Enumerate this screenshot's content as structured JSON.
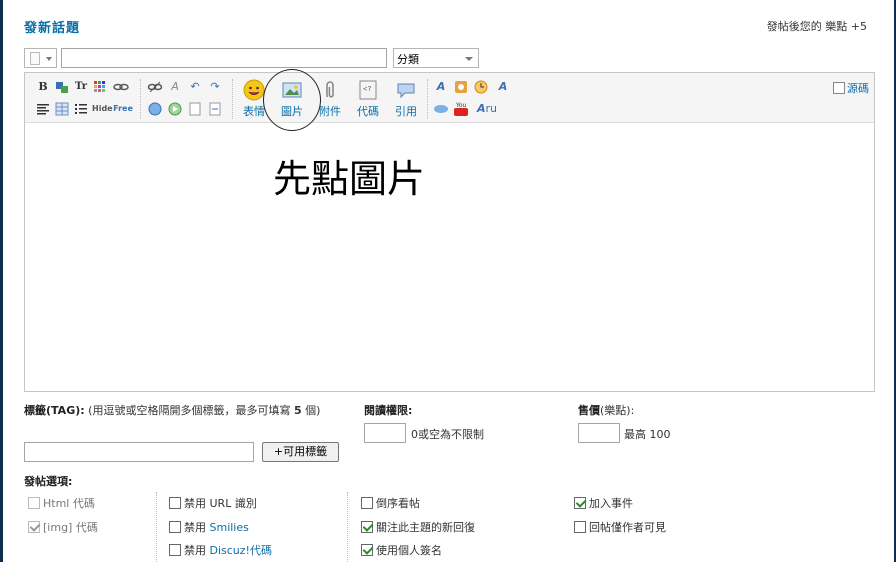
{
  "header": {
    "title": "發新話題",
    "reward": "發帖後您的 樂點 +5"
  },
  "subject": {
    "value": "",
    "category_selected": "分類"
  },
  "toolbar": {
    "big_buttons": [
      "表情",
      "圖片",
      "附件",
      "代碼",
      "引用"
    ],
    "source_label": "源碼",
    "small_icons": {
      "bold": "B",
      "text_size": "Tr",
      "hide": "Hide",
      "free": "Free",
      "ru": "ru"
    }
  },
  "editor": {
    "content": "先點圖片"
  },
  "tags": {
    "label": "標籤(TAG):",
    "desc": "(用逗號或空格隔開多個標籤，最多可填寫",
    "max": "5",
    "desc_end": "個)",
    "button": "+可用標籤",
    "value": ""
  },
  "read_perm": {
    "label": "閱讀權限:",
    "hint": "0或空為不限制",
    "value": ""
  },
  "price": {
    "label": "售價",
    "unit": "(樂點):",
    "hint": "最高 100",
    "value": ""
  },
  "options": {
    "title": "發帖選項:",
    "col1": [
      {
        "label": "Html 代碼",
        "checked": false,
        "disabled": true
      },
      {
        "label": "[img] 代碼",
        "checked": true,
        "disabled": true
      }
    ],
    "col2": [
      {
        "prefix": "禁用",
        "label": "URL 識別",
        "link": false
      },
      {
        "prefix": "禁用",
        "label": "Smilies",
        "link": true
      },
      {
        "prefix": "禁用",
        "label": "Discuz!代碼",
        "link": true
      }
    ],
    "col3": [
      {
        "label": "倒序看帖",
        "checked": false
      },
      {
        "label": "關注此主題的新回復",
        "checked": true
      },
      {
        "label": "使用個人簽名",
        "checked": true
      }
    ],
    "col4": [
      {
        "label": "加入事件",
        "checked": true
      },
      {
        "label": "回帖僅作者可見",
        "checked": false
      }
    ]
  }
}
